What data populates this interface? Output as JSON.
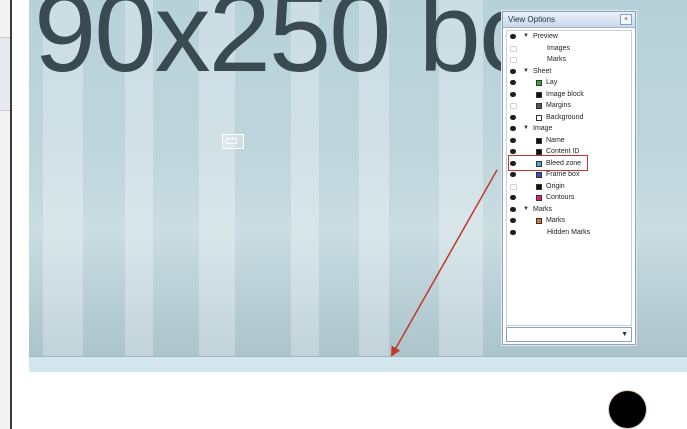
{
  "canvas": {
    "big_text": "90x250 bc"
  },
  "view_options": {
    "title": "View Options",
    "close_icon": "close-icon",
    "dropdown_value": "",
    "items": [
      {
        "label": "Preview",
        "visible": true,
        "group": true
      },
      {
        "label": "Images",
        "visible": false,
        "group": false,
        "swatch": null
      },
      {
        "label": "Marks",
        "visible": false,
        "group": false,
        "swatch": null
      },
      {
        "label": "Sheet",
        "visible": true,
        "group": true
      },
      {
        "label": "Lay",
        "visible": true,
        "group": false,
        "swatch": "#2eaa3c"
      },
      {
        "label": "Image block",
        "visible": true,
        "group": false,
        "swatch": "#111111"
      },
      {
        "label": "Margins",
        "visible": false,
        "group": false,
        "swatch": "#555555"
      },
      {
        "label": "Background",
        "visible": true,
        "group": false,
        "swatch": "#ffffff"
      },
      {
        "label": "Image",
        "visible": true,
        "group": true
      },
      {
        "label": "Name",
        "visible": true,
        "group": false,
        "swatch": "#111111"
      },
      {
        "label": "Content ID",
        "visible": true,
        "group": false,
        "swatch": "#111111"
      },
      {
        "label": "Bleed zone",
        "visible": true,
        "group": false,
        "swatch": "#4aa6d6"
      },
      {
        "label": "Frame box",
        "visible": true,
        "group": false,
        "swatch": "#2d4fd0"
      },
      {
        "label": "Origin",
        "visible": false,
        "group": false,
        "swatch": "#111111"
      },
      {
        "label": "Contours",
        "visible": true,
        "group": false,
        "swatch": "#e0207d"
      },
      {
        "label": "Marks",
        "visible": true,
        "group": true
      },
      {
        "label": "Marks",
        "visible": true,
        "group": false,
        "swatch": "#e8731c"
      },
      {
        "label": "Hidden Marks",
        "visible": true,
        "group": false,
        "swatch": null
      }
    ]
  },
  "colors": {
    "highlight": "#c0392b",
    "arrow": "#c0392b"
  }
}
